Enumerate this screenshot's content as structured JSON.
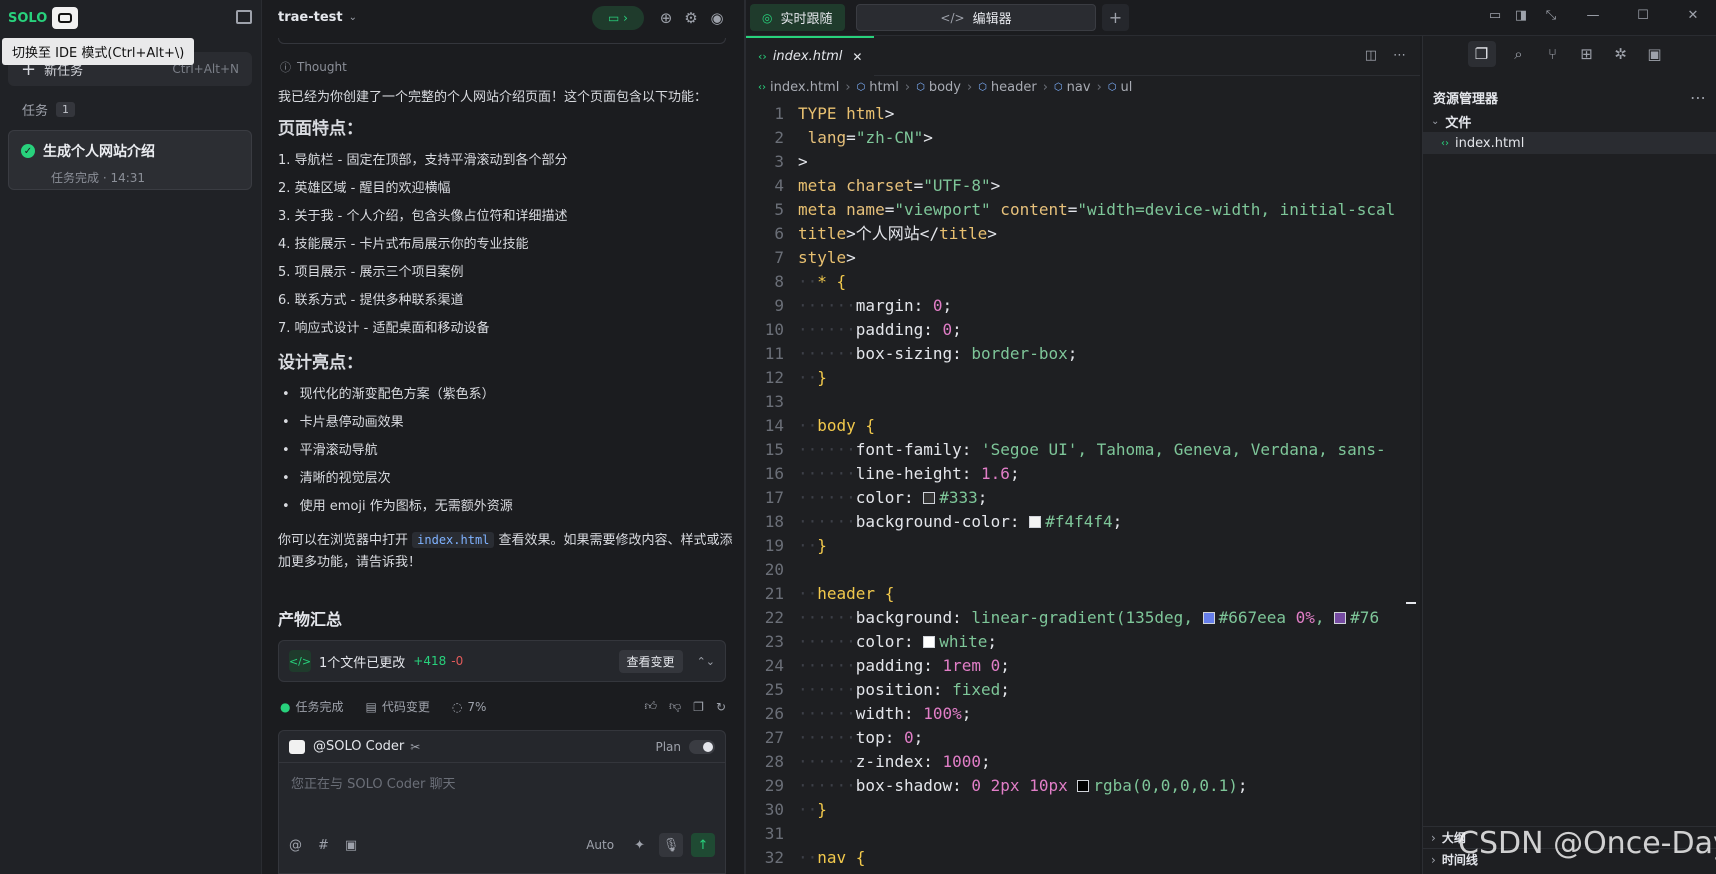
{
  "sidebar": {
    "logo": "SOLO",
    "tooltip": "切换至 IDE 模式(Ctrl+Alt+\\)",
    "new_task_label": "新任务",
    "new_task_shortcut": "Ctrl+Alt+N",
    "tasks_label": "任务",
    "tasks_count": "1",
    "task_title": "生成个人网站介绍",
    "task_status": "任务完成 · 14:31"
  },
  "chat": {
    "project": "trae-test",
    "thought_label": "Thought",
    "intro": "我已经为你创建了一个完整的个人网站介绍页面！这个页面包含以下功能：",
    "features_heading": "页面特点：",
    "features": [
      "1. 导航栏 - 固定在顶部，支持平滑滚动到各个部分",
      "2. 英雄区域 - 醒目的欢迎横幅",
      "3. 关于我 - 个人介绍，包含头像占位符和详细描述",
      "4. 技能展示 - 卡片式布局展示你的专业技能",
      "5. 项目展示 - 展示三个项目案例",
      "6. 联系方式 - 提供多种联系渠道",
      "7. 响应式设计 - 适配桌面和移动设备"
    ],
    "design_heading": "设计亮点：",
    "design": [
      "现代化的渐变配色方案（紫色系）",
      "卡片悬停动画效果",
      "平滑滚动导航",
      "清晰的视觉层次",
      "使用 emoji 作为图标，无需额外资源"
    ],
    "outro_pre": "你可以在浏览器中打开 ",
    "outro_code": "index.html",
    "outro_post": " 查看效果。如果需要修改内容、样式或添加更多功能，请告诉我！",
    "summary_heading": "产物汇总",
    "files_changed": "1个文件已更改",
    "added": "+418",
    "removed": "-0",
    "view_changes": "查看变更",
    "status_done": "任务完成",
    "status_code": "代码变更",
    "status_pct": "7%",
    "agent": "@SOLO Coder",
    "plan_label": "Plan",
    "input_placeholder": "您正在与 SOLO Coder 聊天",
    "mode": "Auto"
  },
  "top": {
    "tab_follow": "实时跟随",
    "tab_editor": "编辑器"
  },
  "editor": {
    "file_tab": "index.html",
    "breadcrumb": [
      "index.html",
      "html",
      "body",
      "header",
      "nav",
      "ul"
    ],
    "lines": [
      [
        [
          "tg",
          "TYPE html"
        ],
        [
          "pr",
          ">"
        ]
      ],
      [
        [
          "at",
          " lang"
        ],
        [
          "pr",
          "="
        ],
        [
          "st",
          "\"zh-CN\""
        ],
        [
          "pr",
          ">"
        ]
      ],
      [
        [
          "pr",
          ">"
        ]
      ],
      [
        [
          "tg",
          "meta"
        ],
        [
          "at",
          " charset"
        ],
        [
          "pr",
          "="
        ],
        [
          "st",
          "\"UTF-8\""
        ],
        [
          "pr",
          ">"
        ]
      ],
      [
        [
          "tg",
          "meta"
        ],
        [
          "at",
          " name"
        ],
        [
          "pr",
          "="
        ],
        [
          "st",
          "\"viewport\""
        ],
        [
          "at",
          " content"
        ],
        [
          "pr",
          "="
        ],
        [
          "st",
          "\"width=device-width, initial-scal"
        ]
      ],
      [
        [
          "tg",
          "title"
        ],
        [
          "pr",
          ">个人网站</"
        ],
        [
          "tg",
          "title"
        ],
        [
          "pr",
          ">"
        ]
      ],
      [
        [
          "tg",
          "style"
        ],
        [
          "pr",
          ">"
        ]
      ],
      [
        [
          "dot",
          "··"
        ],
        [
          "kw",
          "* {"
        ]
      ],
      [
        [
          "dot",
          "······"
        ],
        [
          "pr",
          "margin: "
        ],
        [
          "nm",
          "0"
        ],
        [
          "pr",
          ";"
        ]
      ],
      [
        [
          "dot",
          "······"
        ],
        [
          "pr",
          "padding: "
        ],
        [
          "nm",
          "0"
        ],
        [
          "pr",
          ";"
        ]
      ],
      [
        [
          "dot",
          "······"
        ],
        [
          "pr",
          "box-sizing: "
        ],
        [
          "st",
          "border-box"
        ],
        [
          "pr",
          ";"
        ]
      ],
      [
        [
          "dot",
          "··"
        ],
        [
          "kw",
          "}"
        ]
      ],
      [],
      [
        [
          "dot",
          "··"
        ],
        [
          "kw",
          "body {"
        ]
      ],
      [
        [
          "dot",
          "······"
        ],
        [
          "pr",
          "font-family: "
        ],
        [
          "st",
          "'Segoe UI', Tahoma, Geneva, Verdana, sans-"
        ]
      ],
      [
        [
          "dot",
          "······"
        ],
        [
          "pr",
          "line-height: "
        ],
        [
          "nm",
          "1.6"
        ],
        [
          "pr",
          ";"
        ]
      ],
      [
        [
          "dot",
          "······"
        ],
        [
          "pr",
          "color: "
        ],
        [
          "sw",
          "#333333"
        ],
        [
          "st",
          "#333"
        ],
        [
          "pr",
          ";"
        ]
      ],
      [
        [
          "dot",
          "······"
        ],
        [
          "pr",
          "background-color: "
        ],
        [
          "sw",
          "#f4f4f4"
        ],
        [
          "st",
          "#f4f4f4"
        ],
        [
          "pr",
          ";"
        ]
      ],
      [
        [
          "dot",
          "··"
        ],
        [
          "kw",
          "}"
        ]
      ],
      [],
      [
        [
          "dot",
          "··"
        ],
        [
          "kw",
          "header {"
        ]
      ],
      [
        [
          "dot",
          "······"
        ],
        [
          "pr",
          "background: "
        ],
        [
          "st",
          "linear-gradient(135deg, "
        ],
        [
          "sw",
          "#667eea"
        ],
        [
          "st",
          "#667eea "
        ],
        [
          "nm",
          "0%"
        ],
        [
          "st",
          ", "
        ],
        [
          "sw",
          "#764ba2"
        ],
        [
          "st",
          "#76"
        ]
      ],
      [
        [
          "dot",
          "······"
        ],
        [
          "pr",
          "color: "
        ],
        [
          "sw",
          "#ffffff"
        ],
        [
          "st",
          "white"
        ],
        [
          "pr",
          ";"
        ]
      ],
      [
        [
          "dot",
          "······"
        ],
        [
          "pr",
          "padding: "
        ],
        [
          "nm",
          "1rem 0"
        ],
        [
          "pr",
          ";"
        ]
      ],
      [
        [
          "dot",
          "······"
        ],
        [
          "pr",
          "position: "
        ],
        [
          "st",
          "fixed"
        ],
        [
          "pr",
          ";"
        ]
      ],
      [
        [
          "dot",
          "······"
        ],
        [
          "pr",
          "width: "
        ],
        [
          "nm",
          "100%"
        ],
        [
          "pr",
          ";"
        ]
      ],
      [
        [
          "dot",
          "······"
        ],
        [
          "pr",
          "top: "
        ],
        [
          "nm",
          "0"
        ],
        [
          "pr",
          ";"
        ]
      ],
      [
        [
          "dot",
          "······"
        ],
        [
          "pr",
          "z-index: "
        ],
        [
          "nm",
          "1000"
        ],
        [
          "pr",
          ";"
        ]
      ],
      [
        [
          "dot",
          "······"
        ],
        [
          "pr",
          "box-shadow: "
        ],
        [
          "nm",
          "0 2px 10px "
        ],
        [
          "sw",
          "#000000"
        ],
        [
          "st",
          "rgba(0,0,0,0.1)"
        ],
        [
          "pr",
          ";"
        ]
      ],
      [
        [
          "dot",
          "··"
        ],
        [
          "kw",
          "}"
        ]
      ],
      [],
      [
        [
          "dot",
          "··"
        ],
        [
          "kw",
          "nav {"
        ]
      ]
    ]
  },
  "explorer": {
    "title": "资源管理器",
    "section": "文件",
    "file": "index.html",
    "outline": "大纲",
    "timeline": "时间线"
  },
  "watermark": "CSDN @Once-Day"
}
